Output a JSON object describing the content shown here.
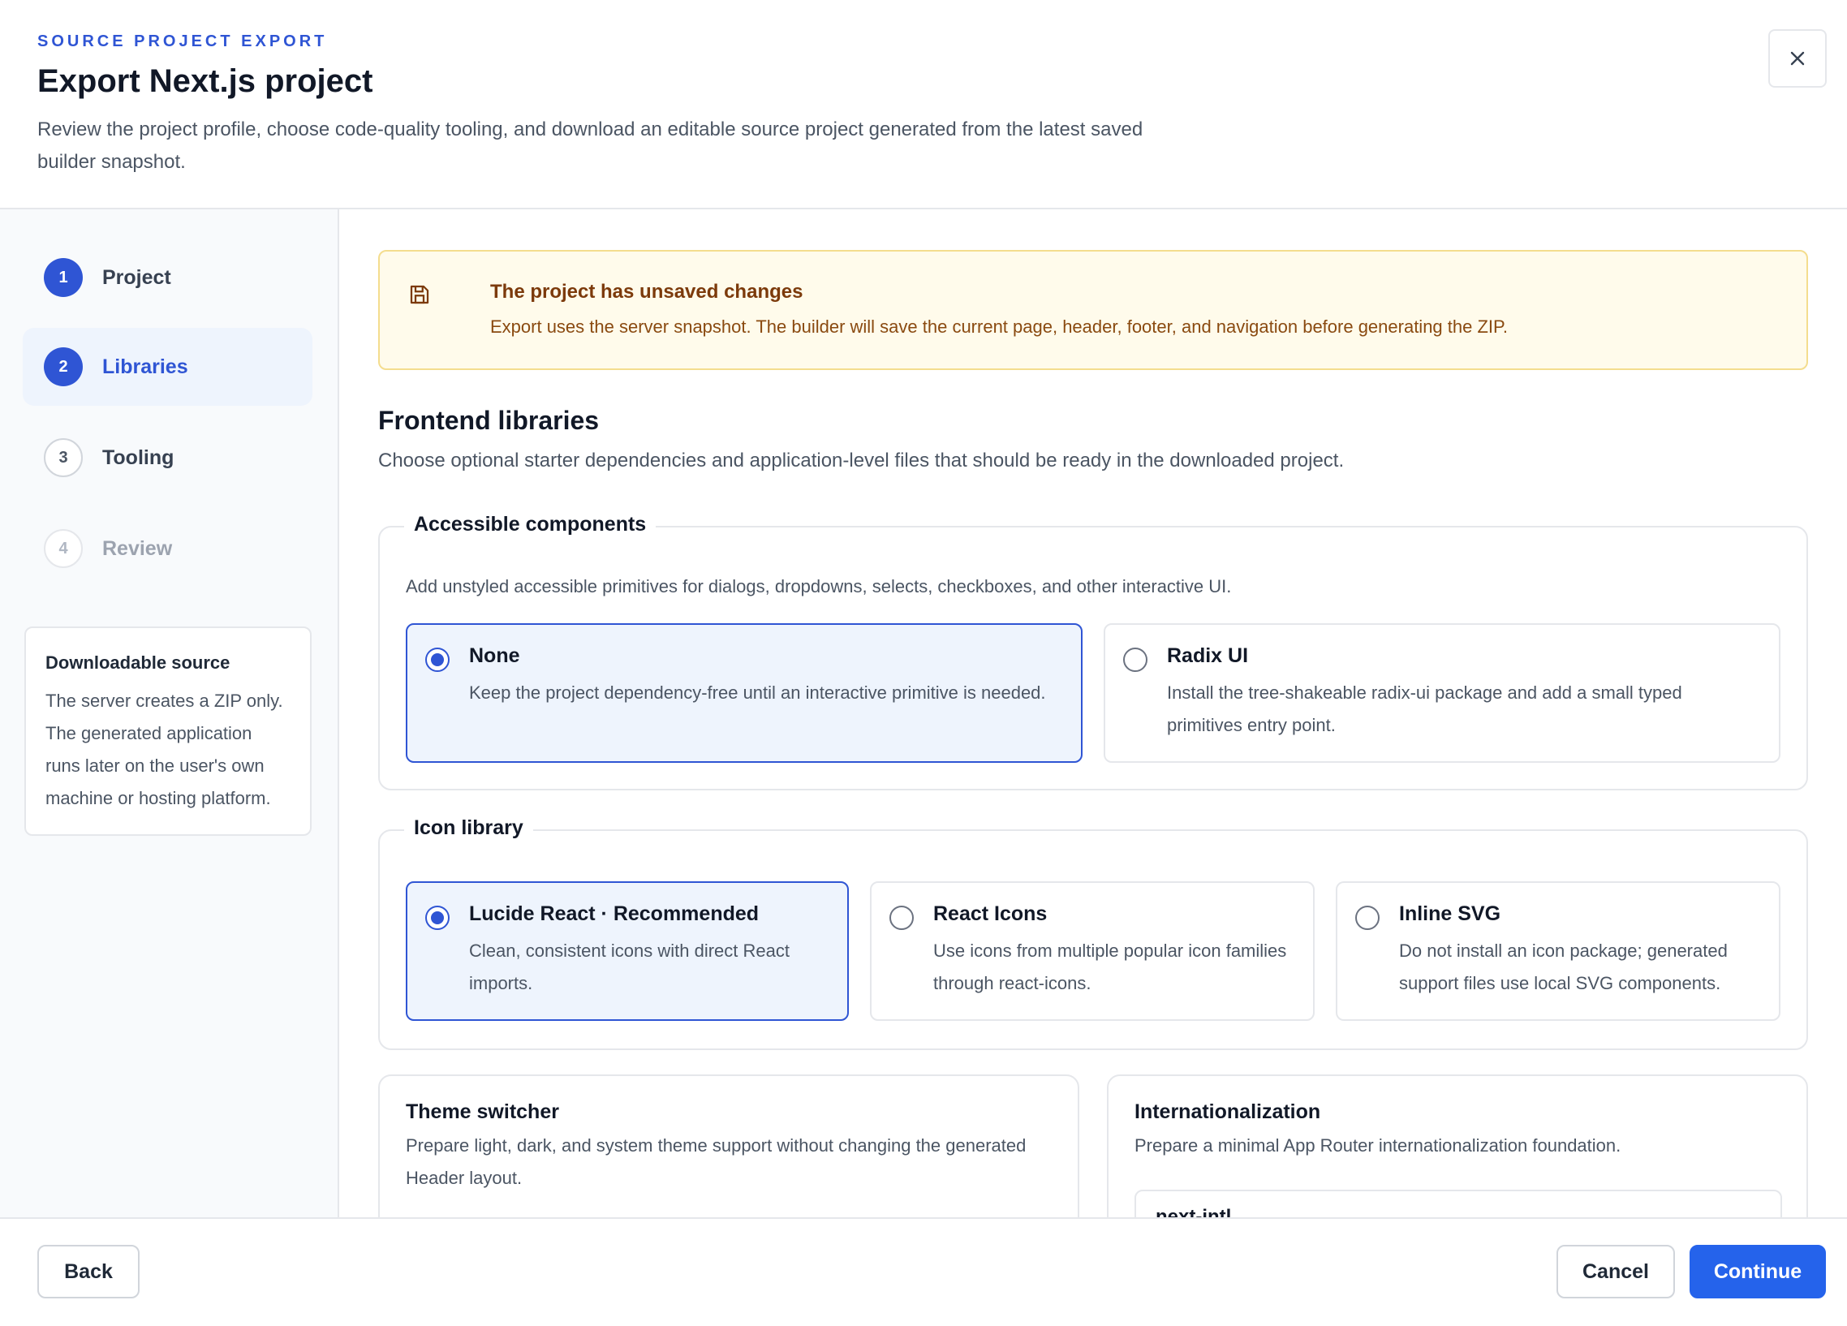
{
  "header": {
    "eyebrow": "SOURCE PROJECT EXPORT",
    "title": "Export Next.js project",
    "description": "Review the project profile, choose code-quality tooling, and download an editable source project generated from the latest saved builder snapshot.",
    "close_icon": "close-icon"
  },
  "sidebar": {
    "steps": [
      {
        "number": "1",
        "label": "Project",
        "state": "complete"
      },
      {
        "number": "2",
        "label": "Libraries",
        "state": "active"
      },
      {
        "number": "3",
        "label": "Tooling",
        "state": "upcoming"
      },
      {
        "number": "4",
        "label": "Review",
        "state": "disabled"
      }
    ],
    "info_card": {
      "title": "Downloadable source",
      "body": "The server creates a ZIP only. The generated application runs later on the user's own machine or hosting platform."
    }
  },
  "alert": {
    "icon": "save-icon",
    "title": "The project has unsaved changes",
    "text": "Export uses the server snapshot. The builder will save the current page, header, footer, and navigation before generating the ZIP."
  },
  "section": {
    "title": "Frontend libraries",
    "description": "Choose optional starter dependencies and application-level files that should be ready in the downloaded project."
  },
  "accessible_components": {
    "legend": "Accessible components",
    "help": "Add unstyled accessible primitives for dialogs, dropdowns, selects, checkboxes, and other interactive UI.",
    "options": [
      {
        "title": "None",
        "description": "Keep the project dependency-free until an interactive primitive is needed.",
        "selected": true
      },
      {
        "title": "Radix UI",
        "description": "Install the tree-shakeable radix-ui package and add a small typed primitives entry point.",
        "selected": false
      }
    ]
  },
  "icon_library": {
    "legend": "Icon library",
    "options": [
      {
        "title": "Lucide React · Recommended",
        "description": "Clean, consistent icons with direct React imports.",
        "selected": true
      },
      {
        "title": "React Icons",
        "description": "Use icons from multiple popular icon families through react-icons.",
        "selected": false
      },
      {
        "title": "Inline SVG",
        "description": "Do not install an icon package; generated support files use local SVG components.",
        "selected": false
      }
    ]
  },
  "theme_switcher": {
    "title": "Theme switcher",
    "description": "Prepare light, dark, and system theme support without changing the generated Header layout."
  },
  "internationalization": {
    "title": "Internationalization",
    "description": "Prepare a minimal App Router internationalization foundation.",
    "option_label": "next-intl"
  },
  "footer": {
    "back_label": "Back",
    "cancel_label": "Cancel",
    "continue_label": "Continue"
  },
  "colors": {
    "accent": "#2f55d4",
    "primary_button": "#2563eb",
    "warning_bg": "#fffbeb",
    "warning_border": "#f4dd8e",
    "selected_bg": "#eef4fd"
  }
}
